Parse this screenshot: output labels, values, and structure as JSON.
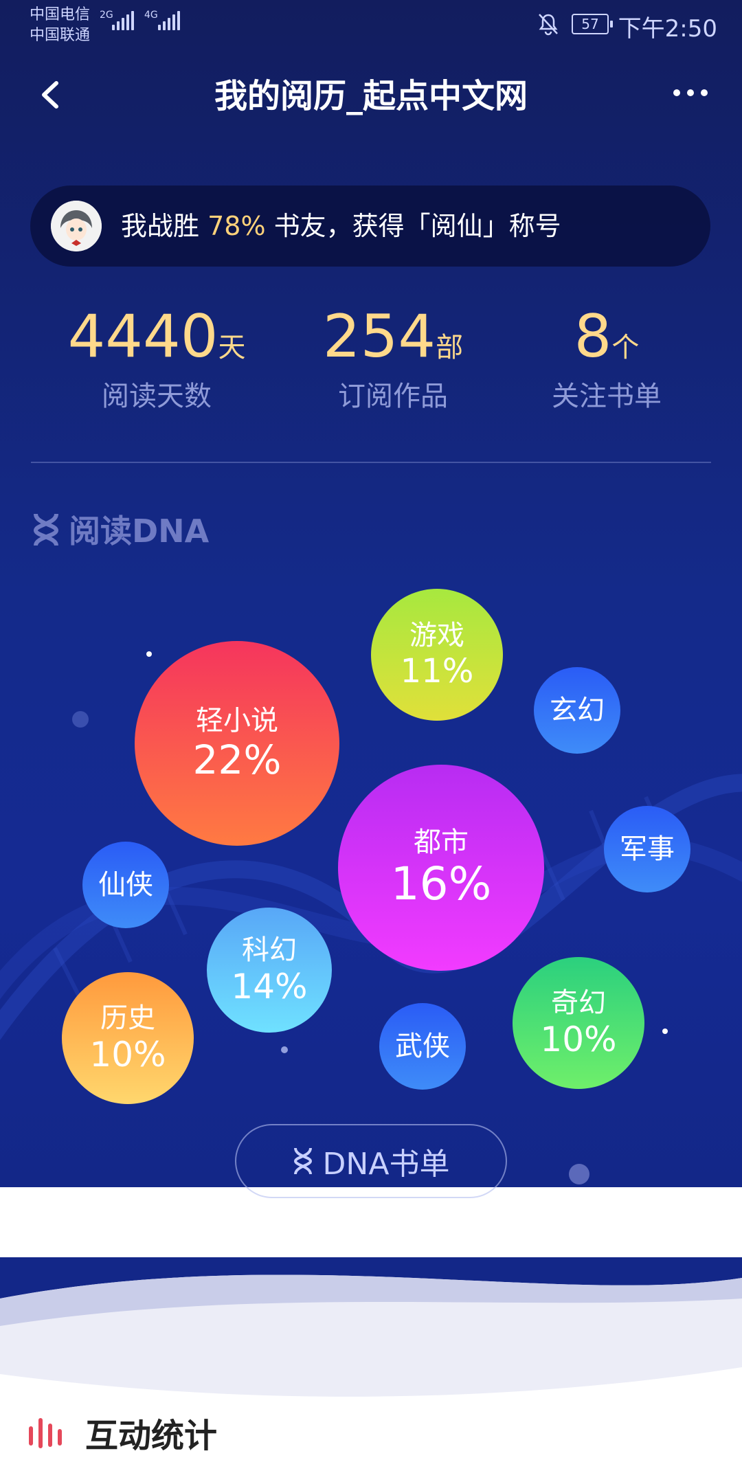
{
  "status": {
    "carrier1": "中国电信",
    "carrier2": "中国联通",
    "net1": "2G",
    "net2": "4G",
    "battery": "57",
    "time": "下午2:50"
  },
  "nav": {
    "title": "我的阅历_起点中文网"
  },
  "achievement": {
    "prefix": "我战胜",
    "percent": "78%",
    "suffix": "书友，获得「阅仙」称号"
  },
  "stats": [
    {
      "value": "4440",
      "unit": "天",
      "label": "阅读天数"
    },
    {
      "value": "254",
      "unit": "部",
      "label": "订阅作品"
    },
    {
      "value": "8",
      "unit": "个",
      "label": "关注书单"
    }
  ],
  "dna": {
    "heading": "阅读DNA",
    "bubbles": [
      {
        "name": "轻小说",
        "percent": "22%"
      },
      {
        "name": "游戏",
        "percent": "11%"
      },
      {
        "name": "玄幻",
        "percent": ""
      },
      {
        "name": "都市",
        "percent": "16%"
      },
      {
        "name": "军事",
        "percent": ""
      },
      {
        "name": "仙侠",
        "percent": ""
      },
      {
        "name": "科幻",
        "percent": "14%"
      },
      {
        "name": "历史",
        "percent": "10%"
      },
      {
        "name": "武侠",
        "percent": ""
      },
      {
        "name": "奇幻",
        "percent": "10%"
      }
    ],
    "button_label": "DNA书单"
  },
  "section2": {
    "title": "互动统计"
  },
  "colors": {
    "bg_top": "#121d5e",
    "bg_mid": "#152a93",
    "accent_gold": "#ffd98b"
  }
}
